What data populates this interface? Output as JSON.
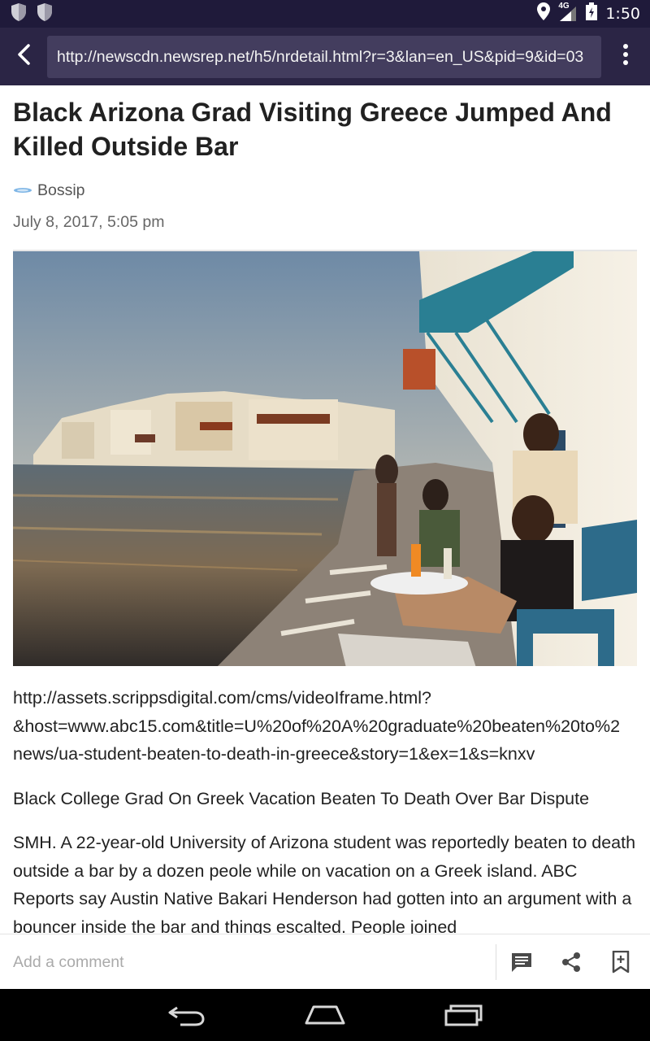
{
  "status_bar": {
    "network": "4G",
    "time": "1:50"
  },
  "toolbar": {
    "url": "http://newscdn.newsrep.net/h5/nrdetail.html?r=3&lan=en_US&pid=9&id=03"
  },
  "article": {
    "headline": "Black Arizona Grad Visiting Greece Jumped And Killed Outside Bar",
    "source": "Bossip",
    "date": "July 8, 2017, 5:05 pm",
    "video_url_lines": [
      "http://assets.scrippsdigital.com/cms/videoIframe.html?",
      "&host=www.abc15.com&title=U%20of%20A%20graduate%20beaten%20to%2",
      "news/ua-student-beaten-to-death-in-greece&story=1&ex=1&s=knxv"
    ],
    "subheading": "Black College Grad On Greek Vacation Beaten To Death Over Bar Dispute",
    "body": "SMH. A 22-year-old University of Arizona student was reportedly beaten to death outside a bar by a dozen peole while on vacation on a Greek island. ABC Reports say Austin Native Bakari Henderson had gotten into an argument with a bouncer inside the bar and things escalted. People joined"
  },
  "comment_bar": {
    "placeholder": "Add a comment"
  },
  "colors": {
    "status_bar_bg": "#1f1a3a",
    "toolbar_bg": "#2b2545",
    "url_box_bg": "#433d5e",
    "nav_bar_bg": "#000000"
  },
  "icons": {
    "status_left": [
      "shield-icon",
      "shield-icon"
    ],
    "status_right": [
      "location-icon",
      "signal-icon",
      "battery-icon"
    ],
    "toolbar": [
      "back-arrow-icon",
      "overflow-menu-icon"
    ],
    "comment_bar": [
      "comment-icon",
      "share-icon",
      "bookmark-add-icon"
    ],
    "nav": [
      "back-icon",
      "home-icon",
      "recents-icon"
    ]
  }
}
